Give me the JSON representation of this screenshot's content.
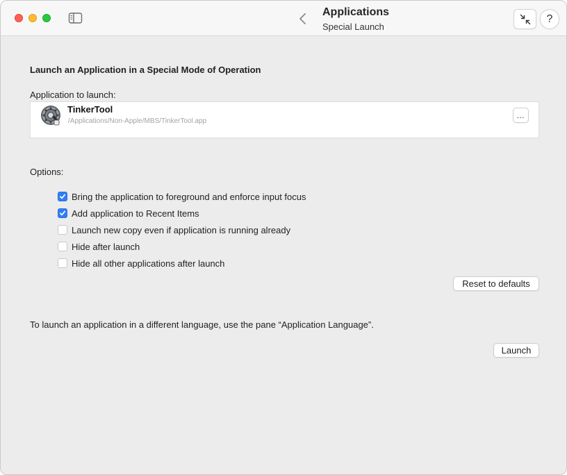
{
  "window": {
    "title": "Applications",
    "subtitle": "Special Launch",
    "help_label": "?"
  },
  "content": {
    "heading": "Launch an Application in a Special Mode of Operation",
    "app_label": "Application to launch:",
    "app": {
      "name": "TinkerTool",
      "path": "/Applications/Non-Apple/MBS/TinkerTool.app",
      "more_label": "…",
      "icon": "gear-app-icon"
    },
    "options_label": "Options:",
    "options": [
      {
        "label": "Bring the application to foreground and enforce input focus",
        "checked": true
      },
      {
        "label": "Add application to Recent Items",
        "checked": true
      },
      {
        "label": "Launch new copy even if application is running already",
        "checked": false
      },
      {
        "label": "Hide after launch",
        "checked": false
      },
      {
        "label": "Hide all other applications after launch",
        "checked": false
      }
    ],
    "reset_label": "Reset to defaults",
    "language_note": "To launch an application in a different language, use the pane “Application Language”.",
    "launch_label": "Launch"
  },
  "colors": {
    "accent": "#2f7ef5",
    "close": "#fe5f57",
    "minimize": "#febc2e",
    "zoom": "#28c840"
  }
}
